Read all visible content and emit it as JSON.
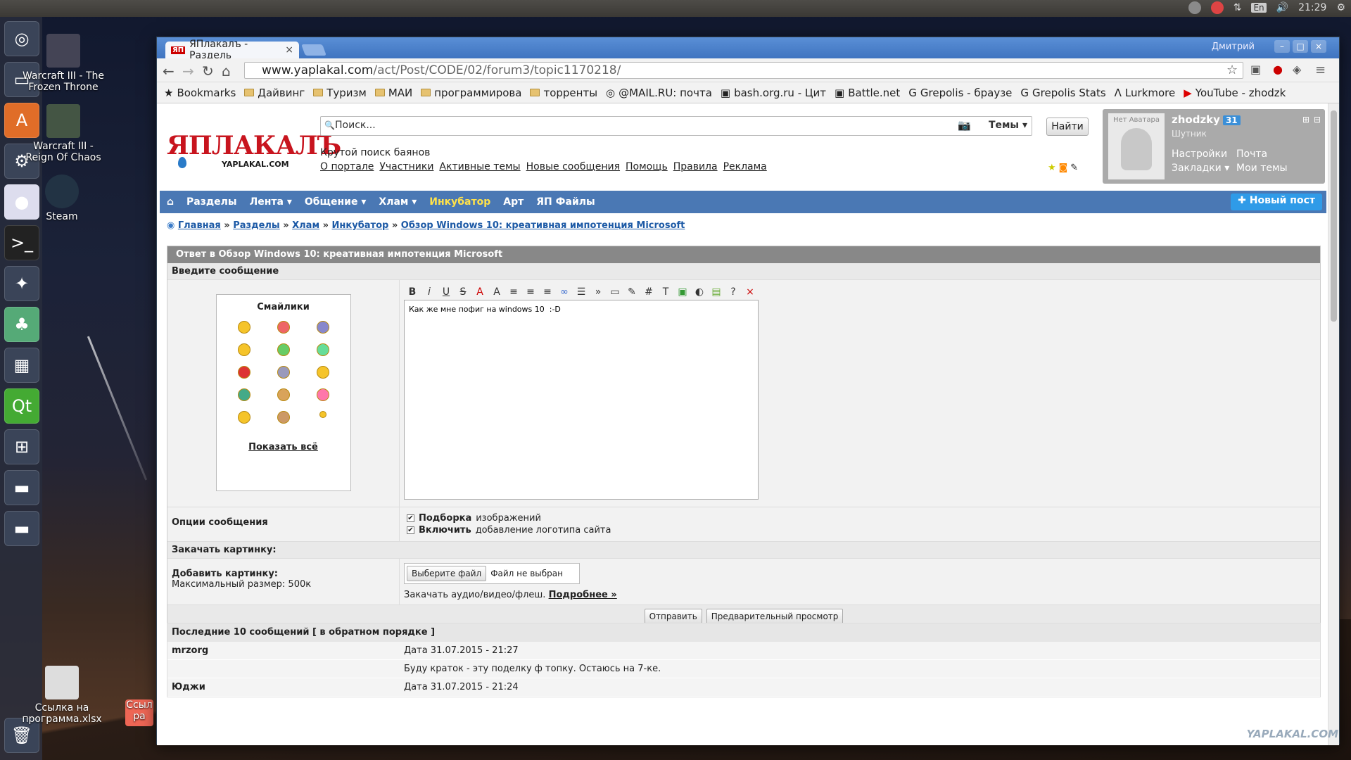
{
  "topbar": {
    "clock": "21:29",
    "lang": "En"
  },
  "desktop": {
    "icons": [
      {
        "label": "Warcraft III - The Frozen Throne"
      },
      {
        "label": "Warcraft III - Reign Of Chaos"
      },
      {
        "label": "Steam"
      },
      {
        "label": "Ссылка на программа.xlsx"
      },
      {
        "label": "Ссыл ра"
      }
    ],
    "watermark": "YAPLAKAL.COM"
  },
  "browser": {
    "window_user": "Дмитрий",
    "tab_title": "ЯПлакалъ - Раздель",
    "tab_favicon": "ЯП",
    "url_host": "www.yaplakal.com",
    "url_path": "/act/Post/CODE/02/forum3/topic1170218/",
    "bookmarks": [
      "Bookmarks",
      "Дайвинг",
      "Туризм",
      "МАИ",
      "программирова",
      "торренты",
      "@MAIL.RU: почта",
      "bash.org.ru - Цит",
      "Battle.net",
      "Grepolis - браузе",
      "Grepolis Stats",
      "Lurkmore",
      "YouTube - zhodzk"
    ]
  },
  "site": {
    "logo": "ЯПЛАКАЛЪ",
    "logo_sub": "YAPLAKAL.COM",
    "search_placeholder": "Поиск...",
    "search_scope": "Темы",
    "find_button": "Найти",
    "tagline": "Крутой поиск баянов",
    "toplinks": [
      "О портале",
      "Участники",
      "Активные темы",
      "Новые сообщения",
      "Помощь",
      "Правила",
      "Реклама"
    ],
    "user": {
      "avatar_label": "Нет Аватара",
      "name": "zhodzky",
      "count": "31",
      "rank": "Шутник",
      "settings": "Настройки",
      "mail": "Почта",
      "bookmarks": "Закладки",
      "my_topics": "Мои темы"
    },
    "menu": [
      "Разделы",
      "Лента",
      "Общение",
      "Хлам",
      "Инкубатор",
      "Арт",
      "ЯП Файлы"
    ],
    "new_post": "Новый пост",
    "crumbs": [
      "Главная",
      "Разделы",
      "Хлам",
      "Инкубатор",
      "Обзор Windows 10: креативная импотенция Microsoft"
    ],
    "form": {
      "title": "Ответ в Обзор Windows 10: креативная импотенция Microsoft",
      "enter_message": "Введите сообщение",
      "smiles_title": "Смайлики",
      "show_all": "Показать всё",
      "message": "Как же мне пофиг на windows 10  :-D",
      "options_label": "Опции сообщения",
      "opt1_bold": "Подборка",
      "opt1_rest": "изображений",
      "opt2_bold": "Включить",
      "opt2_rest": "добавление логотипа сайта",
      "upload_header": "Закачать картинку:",
      "add_picture": "Добавить картинку:",
      "max_size": "Максимальный размер: 500к",
      "choose_file": "Выберите файл",
      "no_file": "Файл не выбран",
      "upload_media": "Закачать аудио/видео/флеш.",
      "more": "Подробнее »",
      "submit": "Отправить",
      "preview": "Предварительный просмотр"
    },
    "recent": {
      "header": "Последние 10 сообщений [ в обратном порядке ]",
      "posts": [
        {
          "author": "mrzorg",
          "date": "Дата 31.07.2015 - 21:27",
          "text": "Буду краток - эту поделку ф топку. Остаюсь на 7-ке."
        },
        {
          "author": "Юджи",
          "date": "Дата 31.07.2015 - 21:24",
          "text": ""
        }
      ]
    }
  }
}
